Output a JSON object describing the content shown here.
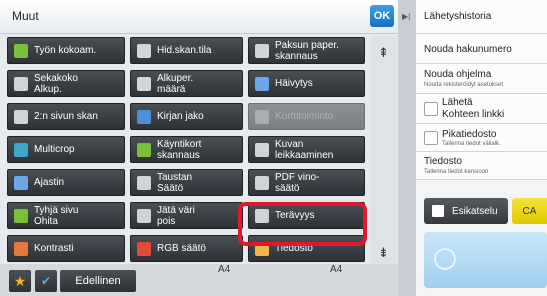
{
  "header": {
    "title": "Muut",
    "ok_label": "OK"
  },
  "functions": [
    {
      "label": "Työn kokoam.",
      "icon": "stack-icon",
      "color": "#7cbf3a"
    },
    {
      "label": "Hid.skan.tila",
      "icon": "document-icon",
      "color": "#cfd4d8"
    },
    {
      "label": "Paksun paper.\nskannaus",
      "icon": "thick-paper-icon",
      "color": "#cfd4d8"
    },
    {
      "label": "Sekakoko\nAlkup.",
      "icon": "mixed-size-icon",
      "color": "#cfd4d8"
    },
    {
      "label": "Alkuper.\nmäärä",
      "icon": "count-icon",
      "color": "#cfd4d8"
    },
    {
      "label": "Häivytys",
      "icon": "fade-icon",
      "color": "#6aa7e8"
    },
    {
      "label": "2:n sivun skan",
      "icon": "two-page-icon",
      "color": "#cfd4d8"
    },
    {
      "label": "Kirjan jako",
      "icon": "book-icon",
      "color": "#4a8fd8"
    },
    {
      "label": "Korttitoiminto",
      "icon": "card-icon",
      "color": "#a9adb1",
      "disabled": true
    },
    {
      "label": "Multicrop",
      "icon": "multicrop-icon",
      "color": "#3da7c7"
    },
    {
      "label": "Käyntikort\nskannaus",
      "icon": "business-card-icon",
      "color": "#7cbf3a"
    },
    {
      "label": "Kuvan\nleikkaaminen",
      "icon": "crop-icon",
      "color": "#cfd4d8"
    },
    {
      "label": "Ajastin",
      "icon": "clock-icon",
      "color": "#6aa7e8"
    },
    {
      "label": "Taustan\nSäätö",
      "icon": "background-icon",
      "color": "#cfd4d8"
    },
    {
      "label": "PDF vino-\nsäätö",
      "icon": "skew-icon",
      "color": "#cfd4d8"
    },
    {
      "label": "Tyhjä sivu\nOhita",
      "icon": "blank-page-icon",
      "color": "#7cbf3a"
    },
    {
      "label": "Jätä väri\npois",
      "icon": "color-drop-icon",
      "color": "#cfd4d8"
    },
    {
      "label": "Terävyys",
      "icon": "sharpness-icon",
      "color": "#cfd4d8"
    },
    {
      "label": "Kontrasti",
      "icon": "contrast-icon",
      "color": "#e8773a"
    },
    {
      "label": "RGB säätö",
      "icon": "rgb-icon",
      "color": "#e24a3c"
    },
    {
      "label": "Tiedosto",
      "icon": "folder-icon",
      "color": "#f0b94a"
    }
  ],
  "scroll": {
    "up_icon": "scroll-up-icon",
    "down_icon": "scroll-down-icon"
  },
  "footer": {
    "prev_label": "Edellinen",
    "paper_1": "A4",
    "paper_2": "A4"
  },
  "right_panel": {
    "history_label": "Lähetyshistoria",
    "recall_number": "Nouda hakunumero",
    "recall_program": "Nouda ohjelma",
    "recall_program_sub": "Nouda rekisteröidyt asetukset",
    "send_link": "Lähetä\nKohteen linkki",
    "quick_file": "Pikatiedosto",
    "quick_file_sub": "Tallenna tiedot välialk.",
    "file": "Tiedosto",
    "file_sub": "Tallenna tiedot kansioon",
    "preview_label": "Esikatselu",
    "ca_label": "CA"
  },
  "colors": {
    "highlight": "#e0192d",
    "ok": "#1670c0",
    "ca": "#f6e33a",
    "start": "#9fd0f0"
  }
}
